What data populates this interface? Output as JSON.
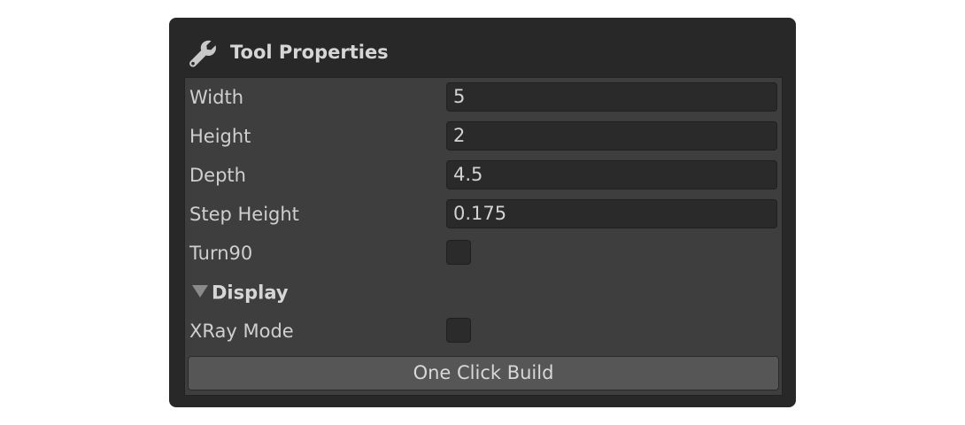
{
  "panel": {
    "title": "Tool Properties",
    "icon": "wrench-icon"
  },
  "properties": [
    {
      "label": "Width",
      "value": "5"
    },
    {
      "label": "Height",
      "value": "2"
    },
    {
      "label": "Depth",
      "value": "4.5"
    },
    {
      "label": "Step Height",
      "value": "0.175"
    }
  ],
  "turn90": {
    "label": "Turn90",
    "checked": false
  },
  "display_section": {
    "label": "Display",
    "expanded": true,
    "xray": {
      "label": "XRay Mode",
      "checked": false
    }
  },
  "build_button": {
    "label": "One Click Build"
  },
  "colors": {
    "panel_bg": "#282828",
    "body_bg": "#3e3e3e",
    "field_bg": "#2a2a2a",
    "button_bg": "#565656",
    "text": "#cfcfcf"
  }
}
